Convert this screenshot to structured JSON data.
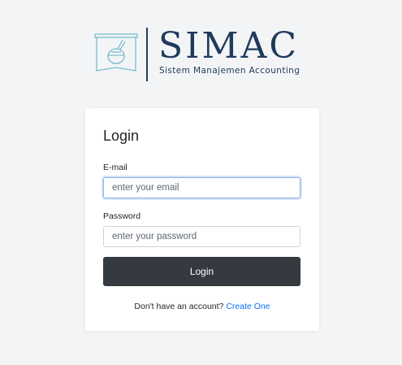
{
  "brand": {
    "name": "SIMAC",
    "tagline": "Sistem Manajemen Accounting",
    "color": "#1f3a5c"
  },
  "login_form": {
    "title": "Login",
    "email_label": "E-mail",
    "email_placeholder": "enter your email",
    "password_label": "Password",
    "password_placeholder": "enter your password",
    "submit_label": "Login",
    "signup_prompt": "Don't have an account?",
    "signup_link": "Create One",
    "button_color": "#343a40",
    "link_color": "#0d6efd"
  }
}
